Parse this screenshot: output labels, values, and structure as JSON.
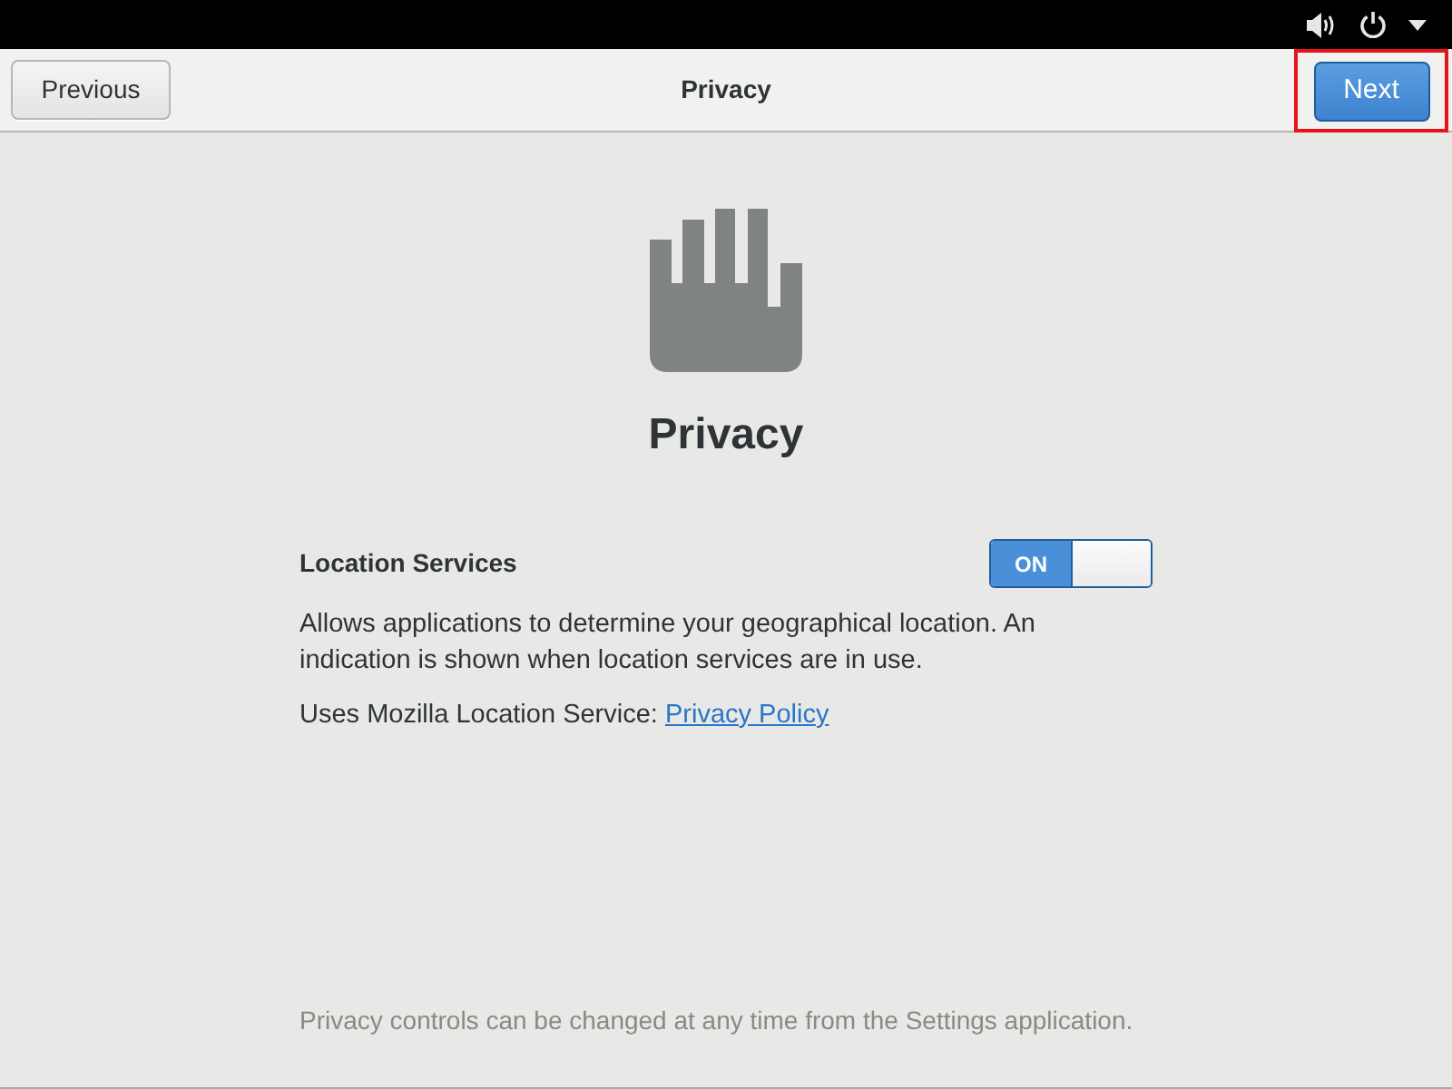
{
  "header": {
    "previous_button": {
      "label": "Previous"
    },
    "title": "Privacy",
    "next_button": {
      "label": "Next",
      "highlighted": true
    }
  },
  "page": {
    "heading": "Privacy",
    "location_services": {
      "label": "Location Services",
      "switch": {
        "on": true,
        "label": "ON"
      },
      "description": "Allows applications to determine your geographical location. An indication is shown when location services are in use.",
      "provider_note": "Uses Mozilla Location Service: ",
      "link": "Privacy Policy"
    },
    "footer": "Privacy controls can be changed at any time from the Settings application."
  }
}
